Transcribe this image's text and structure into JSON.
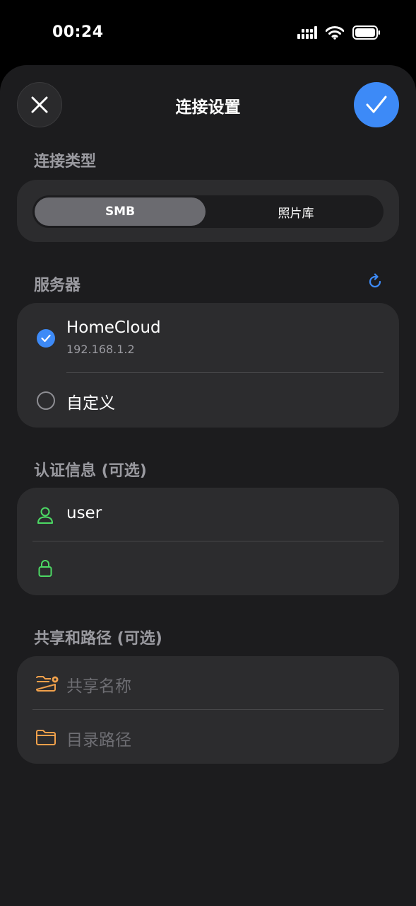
{
  "status": {
    "time": "00:24"
  },
  "nav": {
    "title": "连接设置"
  },
  "connection_type": {
    "label": "连接类型",
    "options": [
      "SMB",
      "照片库"
    ],
    "selected": "SMB"
  },
  "server": {
    "label": "服务器",
    "items": [
      {
        "name": "HomeCloud",
        "address": "192.168.1.2",
        "selected": true
      },
      {
        "name": "自定义",
        "selected": false
      }
    ]
  },
  "auth": {
    "label": "认证信息 (可选)",
    "username": "user",
    "password": ""
  },
  "share": {
    "label": "共享和路径 (可选)",
    "share_placeholder": "共享名称",
    "path_placeholder": "目录路径"
  },
  "colors": {
    "accent": "#3d8af7",
    "user_icon": "#4cd964",
    "folder_icon": "#f0a04b",
    "background": "#1c1c1e",
    "card": "#2c2c2e"
  }
}
